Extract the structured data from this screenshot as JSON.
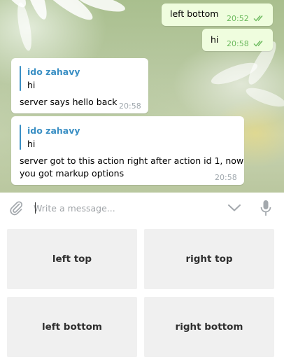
{
  "messages": [
    {
      "direction": "out",
      "text": "left bottom",
      "time": "20:52",
      "status": "read"
    },
    {
      "direction": "out",
      "text": "hi",
      "time": "20:58",
      "status": "read"
    },
    {
      "direction": "in",
      "reply": {
        "name": "ido zahavy",
        "text": "hi"
      },
      "lines": [
        "server says hello back"
      ],
      "time": "20:58"
    },
    {
      "direction": "in",
      "reply": {
        "name": "ido zahavy",
        "text": "hi"
      },
      "lines": [
        "server got to this action right after action id 1, now",
        "you got markup options"
      ],
      "time": "20:58"
    }
  ],
  "composer": {
    "placeholder": "Write a message...",
    "value": "",
    "icons": [
      "paperclip-icon",
      "chevron-down-icon",
      "microphone-icon"
    ]
  },
  "keyboard": {
    "rows": [
      [
        "left top",
        "right top"
      ],
      [
        "left bottom",
        "right bottom"
      ]
    ]
  },
  "colors": {
    "outgoing_bubble": "#effdde",
    "incoming_bubble": "#ffffff",
    "reply_accent": "#3a8fc4",
    "read_checks": "#6cba5e",
    "keyboard_button": "#f0f0f0"
  }
}
